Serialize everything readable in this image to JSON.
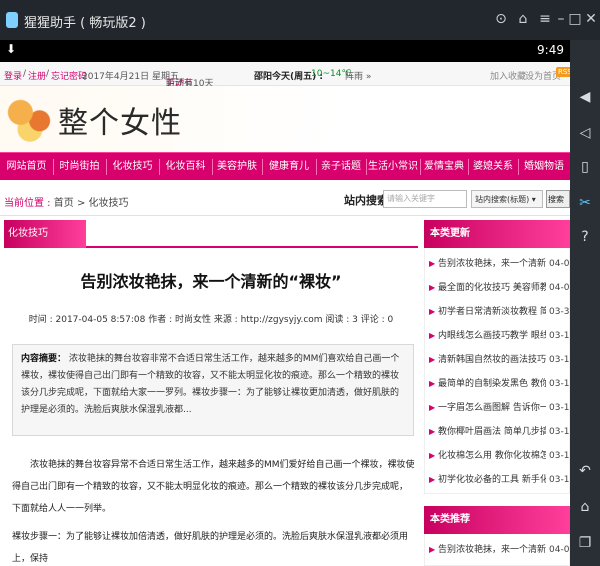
{
  "window": {
    "title": "猩猩助手 ( 畅玩版2 )",
    "controls": [
      "gamepad-icon",
      "pin-icon",
      "menu-icon",
      "minimize-icon",
      "maximize-icon",
      "close-icon"
    ]
  },
  "status_bar": {
    "download_glyph": "⬇",
    "time": "9:49"
  },
  "sidebar_tools": [
    "volume-up-icon",
    "volume-down-icon",
    "shake-icon",
    "screenshot-icon",
    "help-icon",
    "back-icon",
    "home-icon",
    "recent-icon"
  ],
  "topbar": {
    "login": "登录",
    "register": "注册",
    "forgot": "忘记密码",
    "date": "2017年4月21日 星期五",
    "countdown_prefix": "距『",
    "holiday": "劳动节",
    "countdown_suffix": "』还有10天",
    "city": "邵阳",
    "weather_label": "今天(周五) :",
    "temp": "10~14℃",
    "weather_more": "阵雨 »",
    "bookmark": "加入收藏",
    "homepage": "设为首页",
    "rss": "RSS"
  },
  "banner": {
    "brand": "整个女性"
  },
  "nav": [
    "网站首页",
    "时尚街拍",
    "化妆技巧",
    "化妆百科",
    "美容护肤",
    "健康育儿",
    "亲子话题",
    "生活小常识",
    "爱情宝典",
    "婆媳关系",
    "婚姻物语"
  ],
  "crumb": {
    "label": "当前位置 :",
    "home": "首页",
    "sep": ">",
    "current": "化妆技巧",
    "search_label": "站内搜索",
    "search_placeholder": "请输入关键字",
    "search_select": "站内搜索(标题)",
    "search_button": "搜索"
  },
  "article": {
    "category_tab": "化妆技巧",
    "title": "告别浓妆艳抹，来一个清新的“裸妆”",
    "meta": "时间 : 2017-04-05 8:57:08   作者 : 时尚女性   来源 : http://zgysyjy.com   阅读 : 3   评论 : 0",
    "summary_label": "内容摘要：",
    "summary_text": "浓妆艳抹的舞台妆容非常不合适日常生活工作，越来越多的MM们喜欢给自己画一个裸妆，裸妆使得自己出门即有一个精致的妆容，又不能太明显化妆的痕迹。那么一个精致的裸妆该分几步完成呢，下面就给大家一一罗列。裸妆步骤一：为了能够让裸妆更加清透，做好肌肤的护理是必须的。洗脸后爽肤水保湿乳液都...",
    "para1": "浓妆艳抹的舞台妆容异常不合适日常生活工作，越来越多的MM们爱好给自己画一个裸妆，裸妆使得自己出门即有一个精致的妆容，又不能太明显化妆的痕迹。那么一个精致的裸妆该分几步完成呢，下面就给人人一一列举。",
    "para2": "裸妆步骤一：为了能够让裸妆加倍清透，做好肌肤的护理是必须的。洗脸后爽肤水保湿乳液都必须用上，保持"
  },
  "recent": {
    "heading": "本类更新",
    "items": [
      {
        "title": "告别浓妆艳抹，来一个清新",
        "date": "04-05"
      },
      {
        "title": "最全面的化妆技巧 美容师教",
        "date": "04-02"
      },
      {
        "title": "初学者日常清新淡妆教程 简",
        "date": "03-31"
      },
      {
        "title": "内眼线怎么画技巧教学 眼线",
        "date": "03-19"
      },
      {
        "title": "清新韩国自然妆的画法技巧",
        "date": "03-19"
      },
      {
        "title": "最简单的自制染发黑色 教你",
        "date": "03-18"
      },
      {
        "title": "一字眉怎么画图解 告诉你一",
        "date": "03-18"
      },
      {
        "title": "教你椰叶眉画法 简单几步搞",
        "date": "03-17"
      },
      {
        "title": "化妆棉怎么用 教你化妆棉怎",
        "date": "03-17"
      },
      {
        "title": "初学化妆必备的工具 新手化",
        "date": "03-16"
      }
    ]
  },
  "recommend": {
    "heading": "本类推荐",
    "items": [
      {
        "title": "告别浓妆艳抹，来一个清新",
        "date": "04-05"
      }
    ]
  }
}
